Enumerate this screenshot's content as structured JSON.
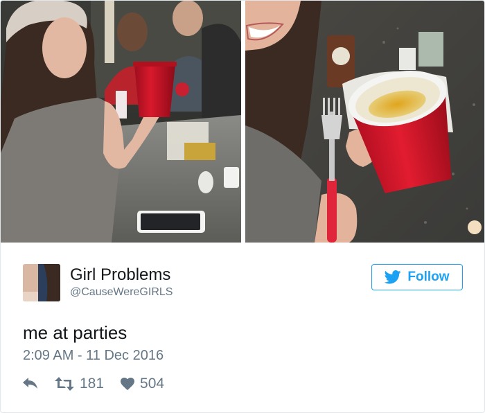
{
  "tweet": {
    "author": {
      "display_name": "Girl Problems",
      "handle": "@CauseWereGIRLS"
    },
    "follow_label": "Follow",
    "text": "me at parties",
    "timestamp": "2:09 AM - 11 Dec 2016",
    "retweet_count": "181",
    "like_count": "504"
  },
  "colors": {
    "twitter_blue": "#1da1f2",
    "text_primary": "#14171a",
    "text_secondary": "#657786",
    "cup_red": "#c8102e"
  },
  "icons": {
    "follow": "twitter-bird-icon",
    "reply": "reply-arrow-icon",
    "retweet": "retweet-icon",
    "like": "heart-icon"
  }
}
